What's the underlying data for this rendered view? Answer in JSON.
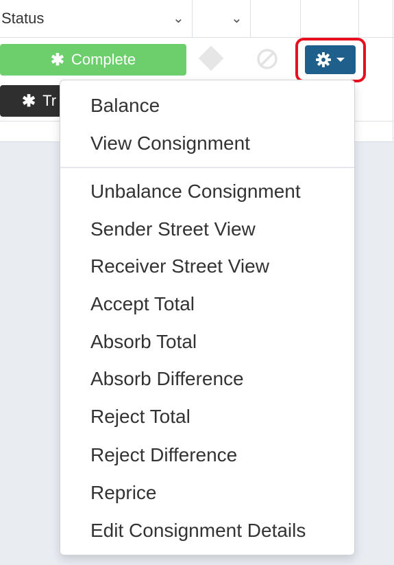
{
  "table": {
    "status_header": "Status",
    "complete_label": "Complete",
    "dark_button_label": "Tr"
  },
  "dropdown": {
    "section1": [
      "Balance",
      "View Consignment"
    ],
    "section2": [
      "Unbalance Consignment",
      "Sender Street View",
      "Receiver Street View",
      "Accept Total",
      "Absorb Total",
      "Absorb Difference",
      "Reject Total",
      "Reject Difference",
      "Reprice",
      "Edit Consignment Details"
    ]
  },
  "colors": {
    "complete_green": "#6ccf6c",
    "gear_button_blue": "#1f5f8b",
    "highlight_red": "#e8101e"
  },
  "icons": [
    "chevron-down-icon",
    "asterisk-icon",
    "diamond-icon",
    "ban-icon",
    "gear-icon",
    "caret-down-icon"
  ]
}
